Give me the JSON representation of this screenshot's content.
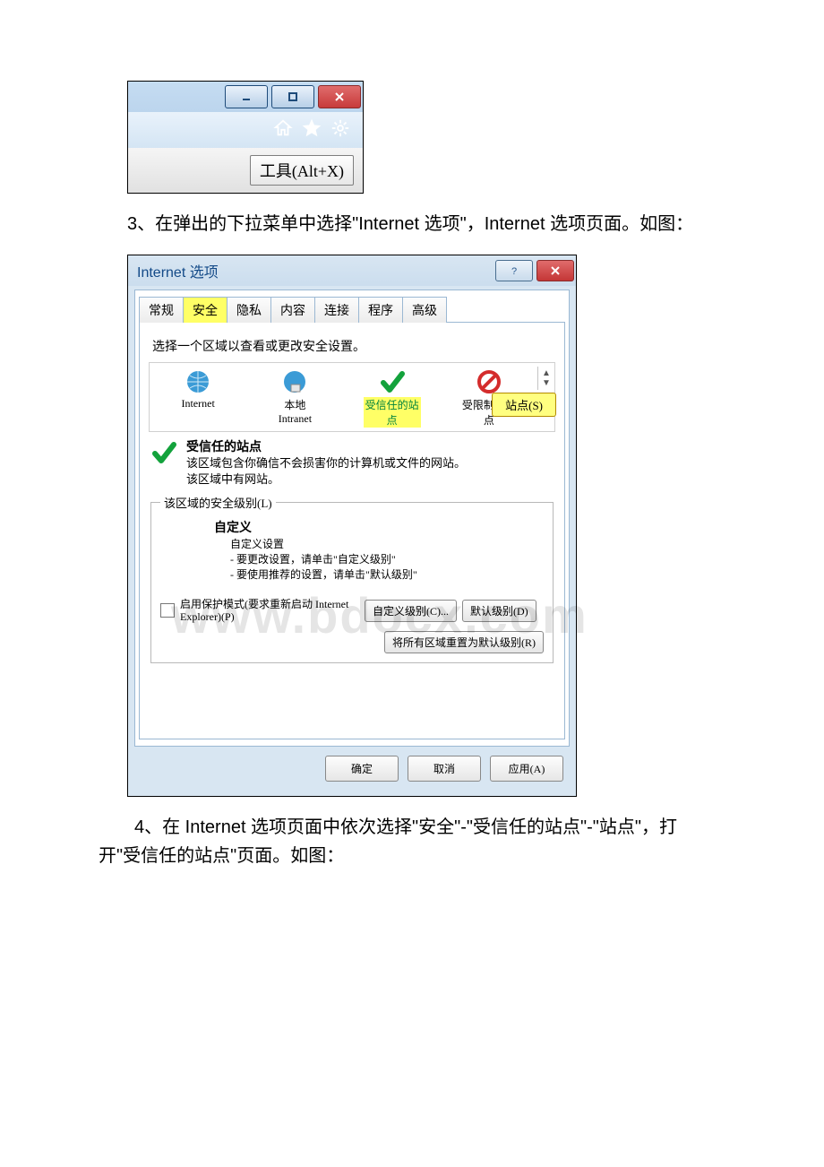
{
  "step3_text": "3、在弹出的下拉菜单中选择\"Internet 选项\"，Internet 选项页面。如图：",
  "step4_text": "4、在 Internet 选项页面中依次选择\"安全\"-\"受信任的站点\"-\"站点\"，打开\"受信任的站点\"页面。如图：",
  "ie_tools_label": "工具(Alt+X)",
  "dialog": {
    "title": "Internet 选项",
    "tabs": [
      "常规",
      "安全",
      "隐私",
      "内容",
      "连接",
      "程序",
      "高级"
    ],
    "active_tab_index": 1,
    "panel": {
      "intro": "选择一个区域以查看或更改安全设置。",
      "zones": [
        {
          "label": "Internet"
        },
        {
          "label": "本地\nIntranet"
        },
        {
          "label": "受信任的站\n点"
        },
        {
          "label": "受限制的站\n点"
        }
      ],
      "sites_button": "站点(S)",
      "detail": {
        "title": "受信任的站点",
        "line1": "该区域包含你确信不会损害你的计算机或文件的网站。",
        "line2": "该区域中有网站。"
      },
      "level_legend": "该区域的安全级别(L)",
      "custom": {
        "title": "自定义",
        "sub_title": "自定义设置",
        "bullet1": "- 要更改设置，请单击\"自定义级别\"",
        "bullet2": "- 要使用推荐的设置，请单击\"默认级别\""
      },
      "protect_label": "启用保护模式(要求重新启动 Internet Explorer)(P)",
      "custom_level_btn": "自定义级别(C)...",
      "default_level_btn": "默认级别(D)",
      "reset_btn": "将所有区域重置为默认级别(R)"
    },
    "footer": {
      "ok": "确定",
      "cancel": "取消",
      "apply": "应用(A)"
    }
  },
  "watermark": "www.bdocx.com"
}
